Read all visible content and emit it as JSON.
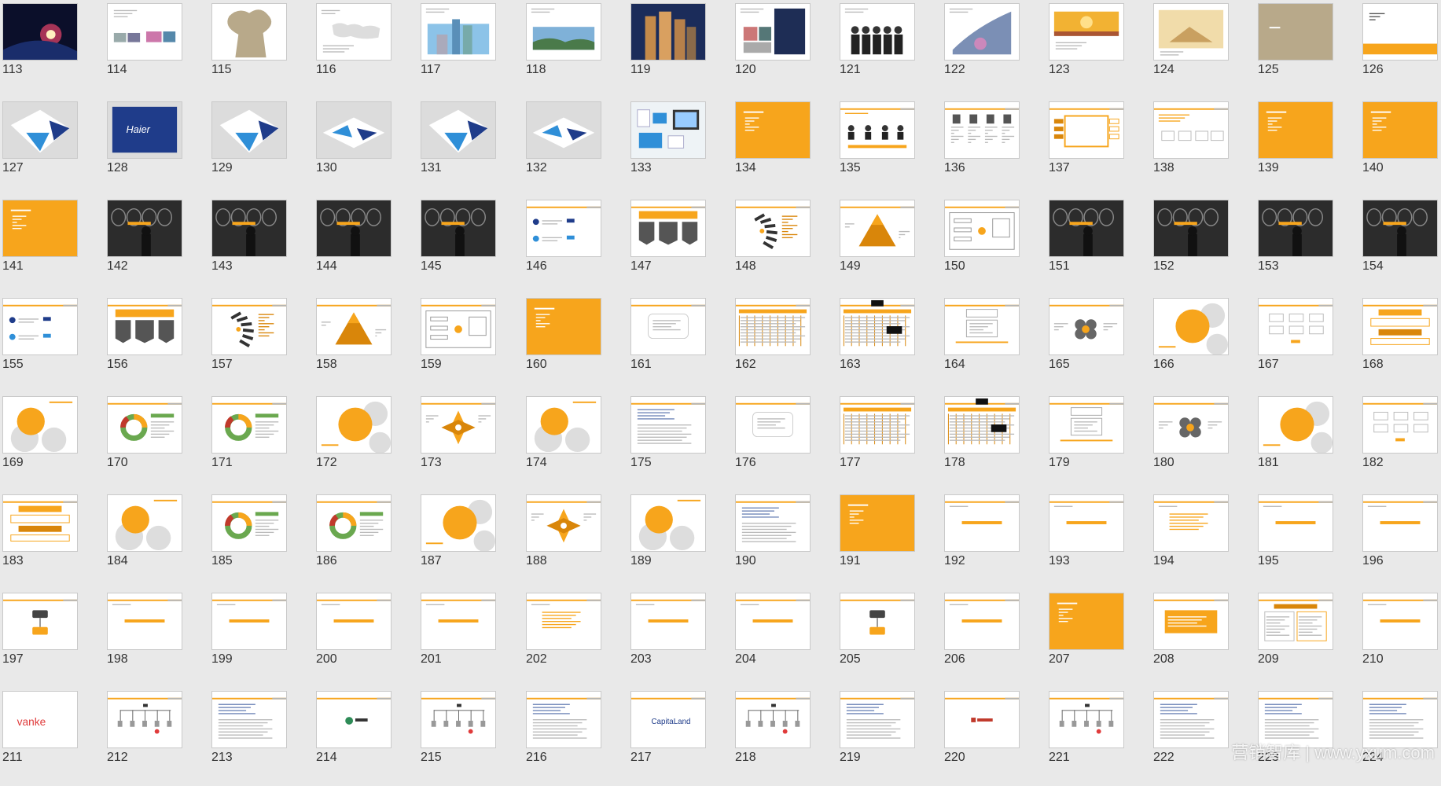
{
  "colors": {
    "background": "#e9e9e9",
    "accent": "#f7a51c",
    "accent_dark": "#d9860a",
    "navy": "#1f3c8a",
    "sky": "#2f8fd8",
    "dark": "#2c2c2c",
    "grey": "#b5b5b5",
    "tan": "#b8a98a"
  },
  "slides": [
    {
      "number": "113",
      "thumb": "space-photo"
    },
    {
      "number": "114",
      "thumb": "text-photos"
    },
    {
      "number": "115",
      "thumb": "tree-silhouette"
    },
    {
      "number": "116",
      "thumb": "world-map"
    },
    {
      "number": "117",
      "thumb": "buildings-photo"
    },
    {
      "number": "118",
      "thumb": "landscape-photo"
    },
    {
      "number": "119",
      "thumb": "city-night"
    },
    {
      "number": "120",
      "thumb": "photo-collage"
    },
    {
      "number": "121",
      "thumb": "group-photo"
    },
    {
      "number": "122",
      "thumb": "skyline-curve"
    },
    {
      "number": "123",
      "thumb": "sunset-photo"
    },
    {
      "number": "124",
      "thumb": "handshake-photo"
    },
    {
      "number": "125",
      "thumb": "tan-full"
    },
    {
      "number": "126",
      "thumb": "orange-bar-bottom"
    },
    {
      "number": "127",
      "thumb": "brochure-blue"
    },
    {
      "number": "128",
      "thumb": "haier-blue"
    },
    {
      "number": "129",
      "thumb": "brochure-blue"
    },
    {
      "number": "130",
      "thumb": "brochure-open"
    },
    {
      "number": "131",
      "thumb": "brochure-blue"
    },
    {
      "number": "132",
      "thumb": "brochure-open"
    },
    {
      "number": "133",
      "thumb": "stationery"
    },
    {
      "number": "134",
      "thumb": "orange-full"
    },
    {
      "number": "135",
      "thumb": "org-people"
    },
    {
      "number": "136",
      "thumb": "people-bios"
    },
    {
      "number": "137",
      "thumb": "flow-chart"
    },
    {
      "number": "138",
      "thumb": "text-boxes"
    },
    {
      "number": "139",
      "thumb": "orange-full"
    },
    {
      "number": "140",
      "thumb": "orange-full"
    },
    {
      "number": "141",
      "thumb": "orange-full"
    },
    {
      "number": "142",
      "thumb": "bulbs-dark"
    },
    {
      "number": "143",
      "thumb": "bulbs-dark"
    },
    {
      "number": "144",
      "thumb": "bulbs-dark"
    },
    {
      "number": "145",
      "thumb": "bulbs-dark"
    },
    {
      "number": "146",
      "thumb": "logos-text"
    },
    {
      "number": "147",
      "thumb": "chevron-diagram"
    },
    {
      "number": "148",
      "thumb": "fan-diagram"
    },
    {
      "number": "149",
      "thumb": "pyramid"
    },
    {
      "number": "150",
      "thumb": "process-diagram"
    },
    {
      "number": "151",
      "thumb": "bulbs-dark"
    },
    {
      "number": "152",
      "thumb": "bulbs-dark"
    },
    {
      "number": "153",
      "thumb": "bulbs-dark"
    },
    {
      "number": "154",
      "thumb": "bulbs-dark"
    },
    {
      "number": "155",
      "thumb": "logos-text"
    },
    {
      "number": "156",
      "thumb": "chevron-diagram"
    },
    {
      "number": "157",
      "thumb": "fan-diagram"
    },
    {
      "number": "158",
      "thumb": "pyramid"
    },
    {
      "number": "159",
      "thumb": "process-diagram"
    },
    {
      "number": "160",
      "thumb": "orange-full"
    },
    {
      "number": "161",
      "thumb": "rounded-box"
    },
    {
      "number": "162",
      "thumb": "table-dense"
    },
    {
      "number": "163",
      "thumb": "table-dense-dark"
    },
    {
      "number": "164",
      "thumb": "box-list"
    },
    {
      "number": "165",
      "thumb": "four-circles"
    },
    {
      "number": "166",
      "thumb": "big-orange-circle"
    },
    {
      "number": "167",
      "thumb": "small-boxes"
    },
    {
      "number": "168",
      "thumb": "layered-bars"
    },
    {
      "number": "169",
      "thumb": "venn-circles"
    },
    {
      "number": "170",
      "thumb": "donut-chart"
    },
    {
      "number": "171",
      "thumb": "donut-chart"
    },
    {
      "number": "172",
      "thumb": "big-orange-circle"
    },
    {
      "number": "173",
      "thumb": "diamond-flower"
    },
    {
      "number": "174",
      "thumb": "venn-circles"
    },
    {
      "number": "175",
      "thumb": "text-list"
    },
    {
      "number": "176",
      "thumb": "rounded-box"
    },
    {
      "number": "177",
      "thumb": "table-dense"
    },
    {
      "number": "178",
      "thumb": "table-dense-dark"
    },
    {
      "number": "179",
      "thumb": "box-list"
    },
    {
      "number": "180",
      "thumb": "four-circles"
    },
    {
      "number": "181",
      "thumb": "big-orange-circle"
    },
    {
      "number": "182",
      "thumb": "small-boxes"
    },
    {
      "number": "183",
      "thumb": "layered-bars"
    },
    {
      "number": "184",
      "thumb": "venn-circles"
    },
    {
      "number": "185",
      "thumb": "donut-chart"
    },
    {
      "number": "186",
      "thumb": "donut-chart"
    },
    {
      "number": "187",
      "thumb": "big-orange-circle"
    },
    {
      "number": "188",
      "thumb": "diamond-flower"
    },
    {
      "number": "189",
      "thumb": "venn-circles"
    },
    {
      "number": "190",
      "thumb": "text-list"
    },
    {
      "number": "191",
      "thumb": "orange-full"
    },
    {
      "number": "192",
      "thumb": "orange-heading"
    },
    {
      "number": "193",
      "thumb": "orange-heading"
    },
    {
      "number": "194",
      "thumb": "orange-lines"
    },
    {
      "number": "195",
      "thumb": "orange-heading"
    },
    {
      "number": "196",
      "thumb": "orange-heading"
    },
    {
      "number": "197",
      "thumb": "node-diagram"
    },
    {
      "number": "198",
      "thumb": "orange-heading"
    },
    {
      "number": "199",
      "thumb": "orange-heading"
    },
    {
      "number": "200",
      "thumb": "orange-heading"
    },
    {
      "number": "201",
      "thumb": "orange-heading"
    },
    {
      "number": "202",
      "thumb": "orange-lines"
    },
    {
      "number": "203",
      "thumb": "orange-heading"
    },
    {
      "number": "204",
      "thumb": "orange-heading"
    },
    {
      "number": "205",
      "thumb": "node-diagram"
    },
    {
      "number": "206",
      "thumb": "orange-heading"
    },
    {
      "number": "207",
      "thumb": "orange-full"
    },
    {
      "number": "208",
      "thumb": "orange-box"
    },
    {
      "number": "209",
      "thumb": "two-columns"
    },
    {
      "number": "210",
      "thumb": "orange-heading"
    },
    {
      "number": "211",
      "thumb": "vanke-logo"
    },
    {
      "number": "212",
      "thumb": "tree-diagram"
    },
    {
      "number": "213",
      "thumb": "text-list"
    },
    {
      "number": "214",
      "thumb": "center-logo"
    },
    {
      "number": "215",
      "thumb": "tree-diagram"
    },
    {
      "number": "216",
      "thumb": "text-list"
    },
    {
      "number": "217",
      "thumb": "capitaland-logo"
    },
    {
      "number": "218",
      "thumb": "tree-diagram"
    },
    {
      "number": "219",
      "thumb": "text-list"
    },
    {
      "number": "220",
      "thumb": "red-logo"
    },
    {
      "number": "221",
      "thumb": "tree-diagram"
    },
    {
      "number": "222",
      "thumb": "text-list"
    },
    {
      "number": "223",
      "thumb": "text-list"
    },
    {
      "number": "224",
      "thumb": "text-list"
    }
  ],
  "watermark": "营销智库 | www.yxum.com"
}
